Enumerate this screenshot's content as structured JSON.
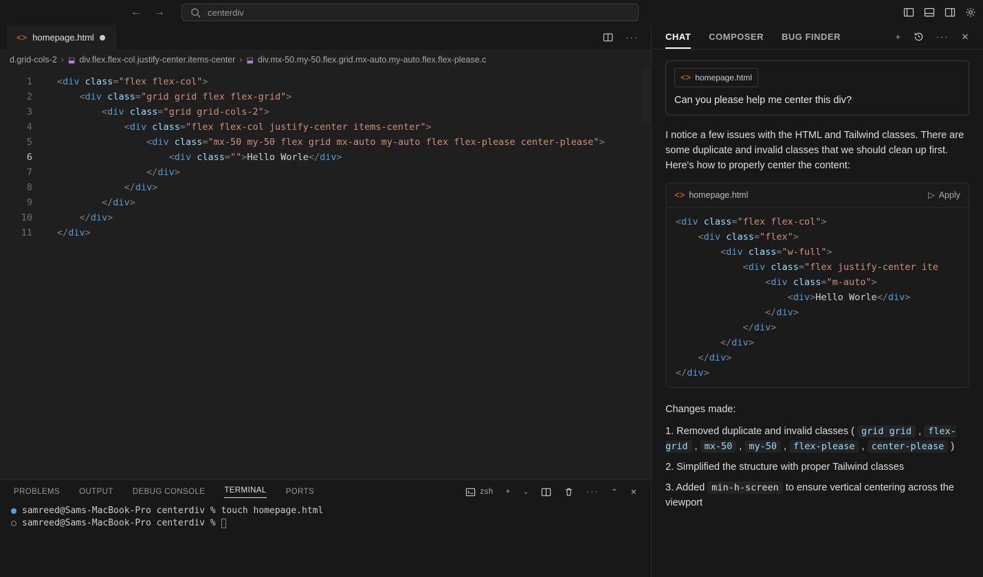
{
  "titlebar": {
    "search": "centerdiv"
  },
  "tab": {
    "filename": "homepage.html"
  },
  "breadcrumb": {
    "seg1": "d.grid-cols-2",
    "seg2": "div.flex.flex-col.justify-center.items-center",
    "seg3": "div.mx-50.my-50.flex.grid.mx-auto.my-auto.flex.flex-please.c"
  },
  "editor": {
    "lines": [
      "1",
      "2",
      "3",
      "4",
      "5",
      "6",
      "7",
      "8",
      "9",
      "10",
      "11"
    ]
  },
  "panel": {
    "tabs": {
      "problems": "PROBLEMS",
      "output": "OUTPUT",
      "debug": "DEBUG CONSOLE",
      "terminal": "TERMINAL",
      "ports": "PORTS"
    },
    "shell": "zsh",
    "term1": "samreed@Sams-MacBook-Pro centerdiv % touch homepage.html",
    "term2": "samreed@Sams-MacBook-Pro centerdiv % "
  },
  "chat": {
    "tabs": {
      "chat": "CHAT",
      "composer": "COMPOSER",
      "bug": "BUG FINDER"
    },
    "user_chip": "homepage.html",
    "user_text": "Can you please help me center this div?",
    "assistant_p1": "I notice a few issues with the HTML and Tailwind classes. There are some duplicate and invalid classes that we should clean up first. Here's how to properly center the content:",
    "code_file": "homepage.html",
    "apply": "Apply",
    "changes_heading": "Changes made:",
    "item1_prefix": "1. Removed duplicate and invalid classes ( ",
    "c1": "grid grid",
    "c2": "flex-grid",
    "c3": "mx-50",
    "c4": "my-50",
    "c5": "flex-please",
    "c6": "center-please",
    "item1_suffix": " )",
    "item2": "2. Simplified the structure with proper Tailwind classes",
    "item3_a": "3. Added ",
    "item3_code": "min-h-screen",
    "item3_b": " to ensure vertical centering across the viewport"
  }
}
